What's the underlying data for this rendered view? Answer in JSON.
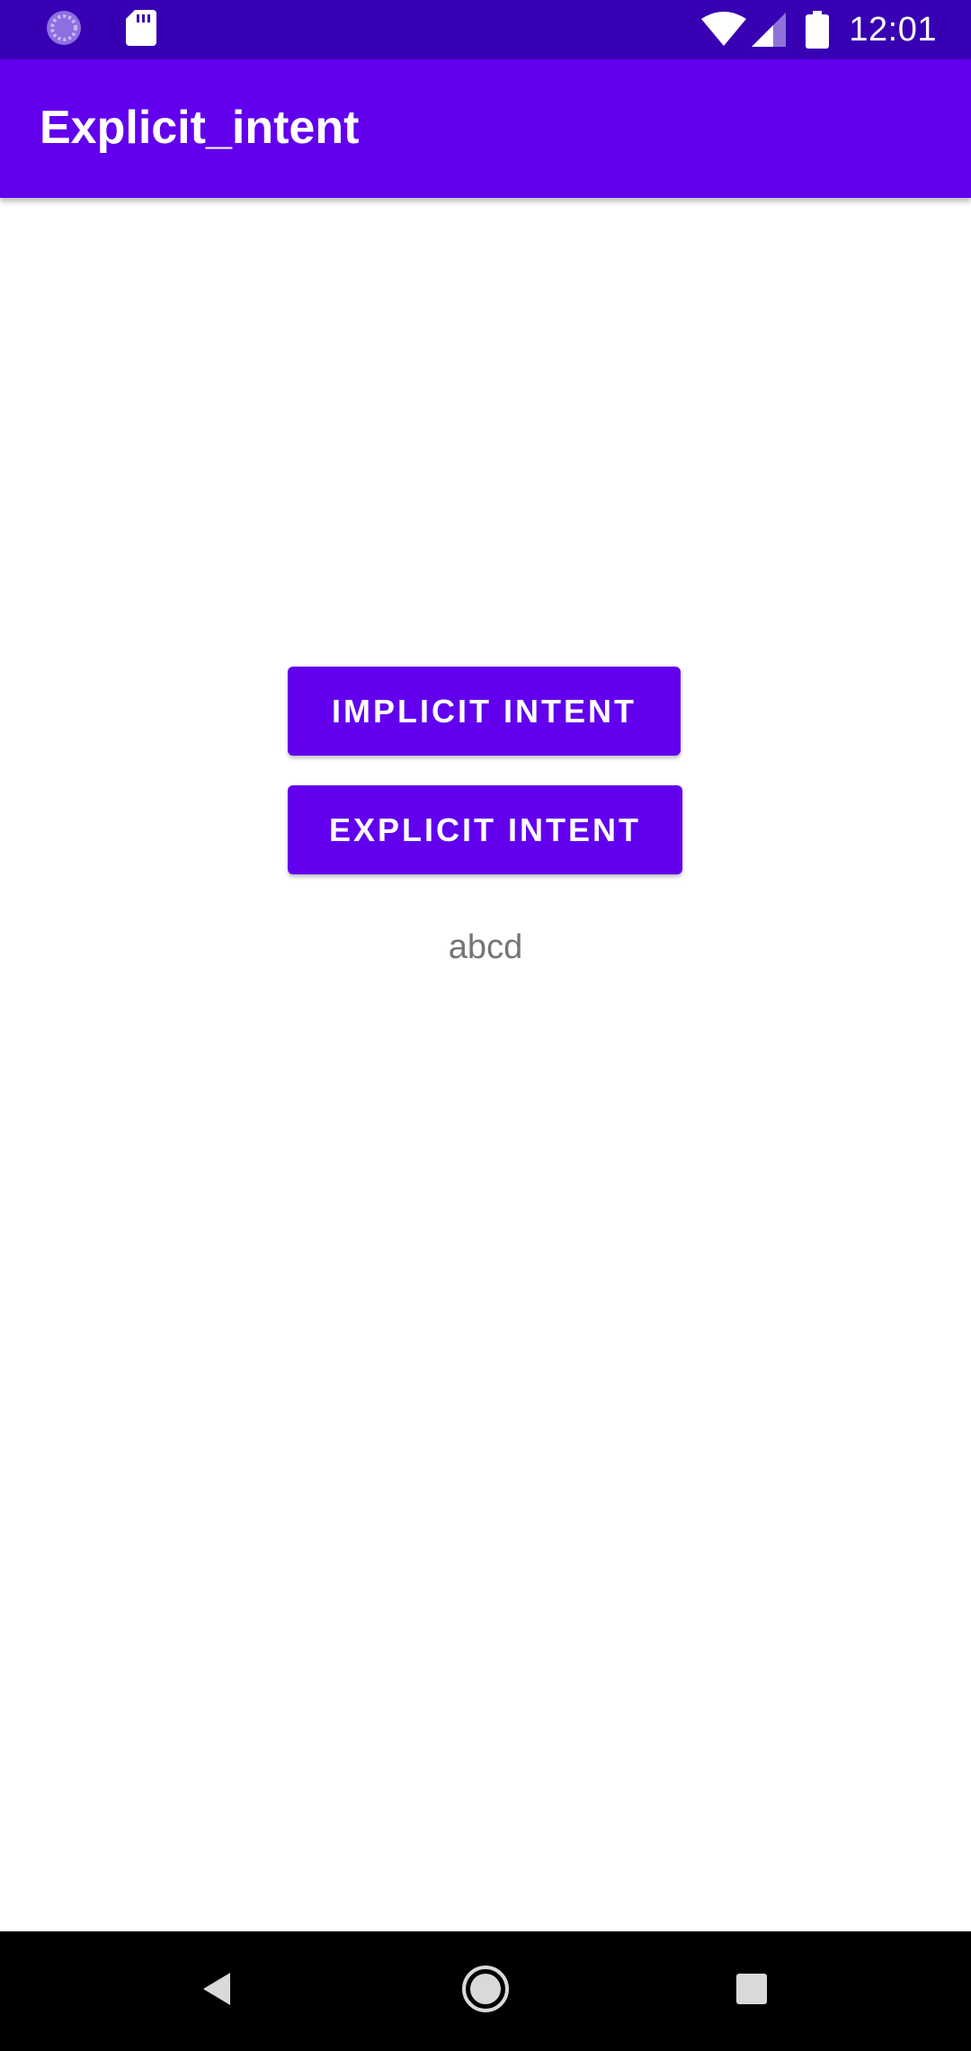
{
  "status_bar": {
    "time": "12:01",
    "icons": [
      "loading-circle-icon",
      "sd-card-icon",
      "wifi-icon",
      "cell-signal-icon",
      "battery-icon"
    ],
    "background_color": "#3700b3"
  },
  "app_bar": {
    "title": "Explicit_intent",
    "background_color": "#6200ee"
  },
  "main": {
    "implicit_button_label": "IMPLICIT INTENT",
    "explicit_button_label": "EXPLICIT INTENT",
    "result_text": "abcd",
    "accent_color": "#6200ee"
  },
  "nav_bar": {
    "icons": [
      "back-icon",
      "home-icon",
      "recents-icon"
    ]
  }
}
